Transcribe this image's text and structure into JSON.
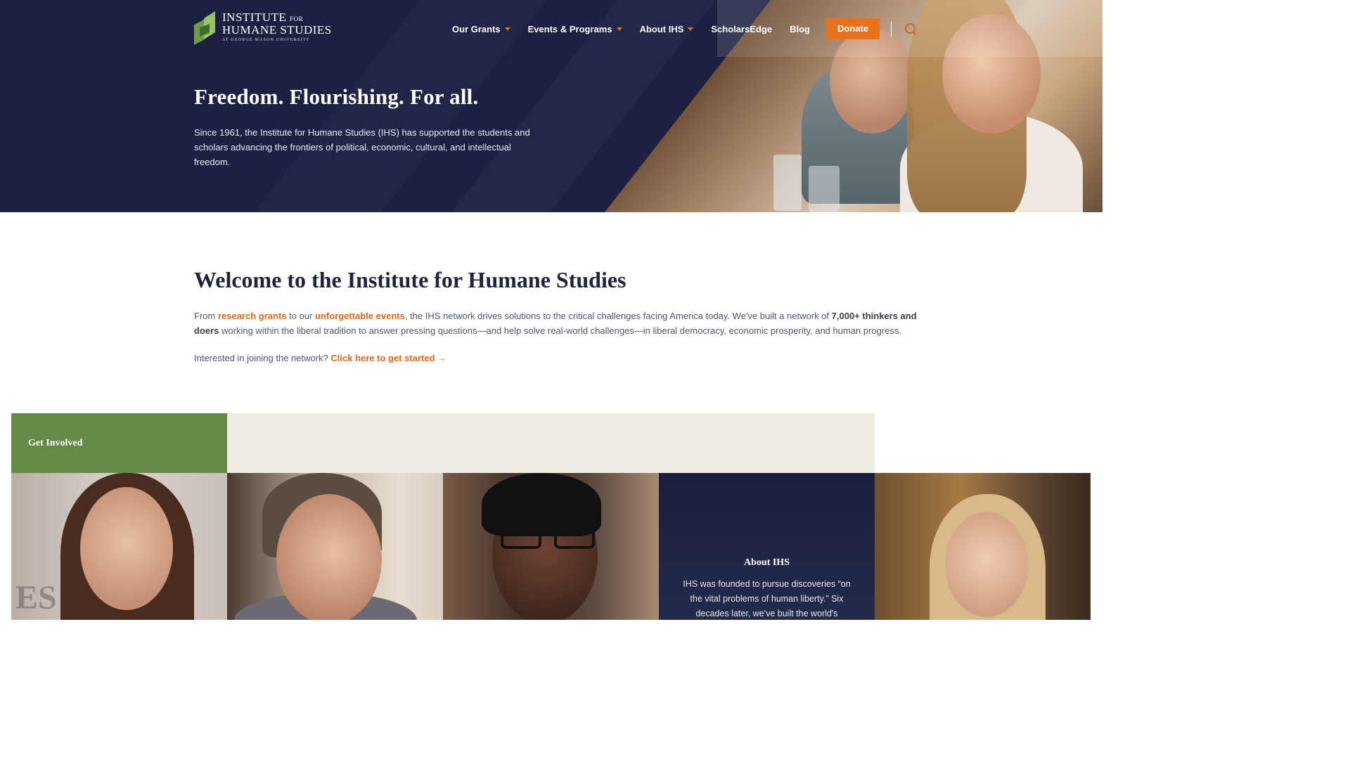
{
  "logo": {
    "line1": "INSTITUTE",
    "line1_small": "FOR",
    "line2": "HUMANE STUDIES",
    "line3": "AT GEORGE MASON UNIVERSITY"
  },
  "nav": {
    "items": [
      {
        "label": "Our Grants",
        "dropdown": true
      },
      {
        "label": "Events & Programs",
        "dropdown": true
      },
      {
        "label": "About IHS",
        "dropdown": true
      },
      {
        "label": "ScholarsEdge",
        "dropdown": false
      },
      {
        "label": "Blog",
        "dropdown": false
      }
    ],
    "donate_label": "Donate",
    "search_icon": "search-icon"
  },
  "hero": {
    "title": "Freedom. Flourishing. For all.",
    "description": "Since 1961, the Institute for Humane Studies (IHS) has supported the students and scholars advancing the frontiers of political, economic, cultural, and intellectual freedom."
  },
  "welcome": {
    "title": "Welcome to the Institute for Humane Studies",
    "text_from": "From ",
    "link_research_grants": "research grants",
    "text_to_our": " to our ",
    "link_unforgettable_events": "unforgettable events",
    "text_middle": ", the IHS network drives solutions to the critical challenges facing America today. We've built a network of ",
    "bold_network": "7,000+ thinkers and doers",
    "text_end": " working within the liberal tradition to answer pressing questions—and help solve real-world challenges—in liberal democracy, economic prosperity, and human progress.",
    "join_prefix": "Interested in joining the network? ",
    "join_link": "Click here to get started →"
  },
  "get_involved": {
    "tab_label": "Get Involved"
  },
  "about_tile": {
    "title": "About IHS",
    "text": "IHS was founded to pursue discoveries “on the vital problems of human liberty.” Six decades later, we've built the world's"
  },
  "colors": {
    "navy": "#1c2142",
    "orange": "#e8711e",
    "green": "#648a48",
    "beige": "#efede3"
  }
}
